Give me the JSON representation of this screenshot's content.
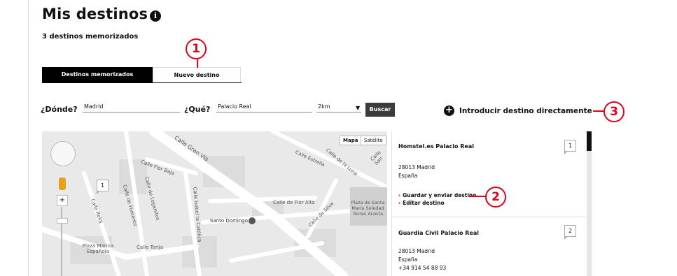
{
  "page": {
    "title": "Mis destinos",
    "info_icon": "i",
    "subtitle": "3 destinos memorizados"
  },
  "tabs": [
    {
      "label": "Destinos memorizados"
    },
    {
      "label": "Nuevo destino"
    }
  ],
  "callouts": [
    "1",
    "2",
    "3"
  ],
  "search": {
    "where_label": "¿Dónde?",
    "where_value": "Madrid",
    "what_label": "¿Qué?",
    "what_value": "Palacio Real",
    "radius_value": "2km",
    "search_button": "Buscar",
    "direct_link": "Introducir destino directamente",
    "plus_icon": "+"
  },
  "map": {
    "toggle_map": "Mapa",
    "toggle_satellite": "Satélite",
    "zoom_plus": "+",
    "pin_number": "1",
    "street_labels": [
      "Calle Gran Vía",
      "Calle Flor Baja",
      "Calle de Leganitos",
      "Calle de Fomento",
      "Calle Reloj",
      "Calle Isabel la Católica",
      "Calle de Flor Alta",
      "Calle Estrella",
      "Calle de la Luna",
      "Calle de Silva",
      "Calle Torija",
      "Santo Domingo",
      "Plaza Marina Española",
      "Plaza de Santa María Soledad Torres Acosta",
      "Calle San"
    ]
  },
  "results": [
    {
      "number": "1",
      "name": "Homstel.es Palacio Real",
      "address_line1": "28013 Madrid",
      "address_line2": "España",
      "link1": "Guardar y enviar destino",
      "link2": "Editar destino"
    },
    {
      "number": "2",
      "name": "Guardia Civil Palacio Real",
      "address_line1": "28013 Madrid",
      "address_line2": "España",
      "phone": "+34 914 54 88 93"
    }
  ],
  "colors": {
    "accent_red": "#d9041e",
    "dark": "#000000",
    "button": "#3b3b3b"
  }
}
